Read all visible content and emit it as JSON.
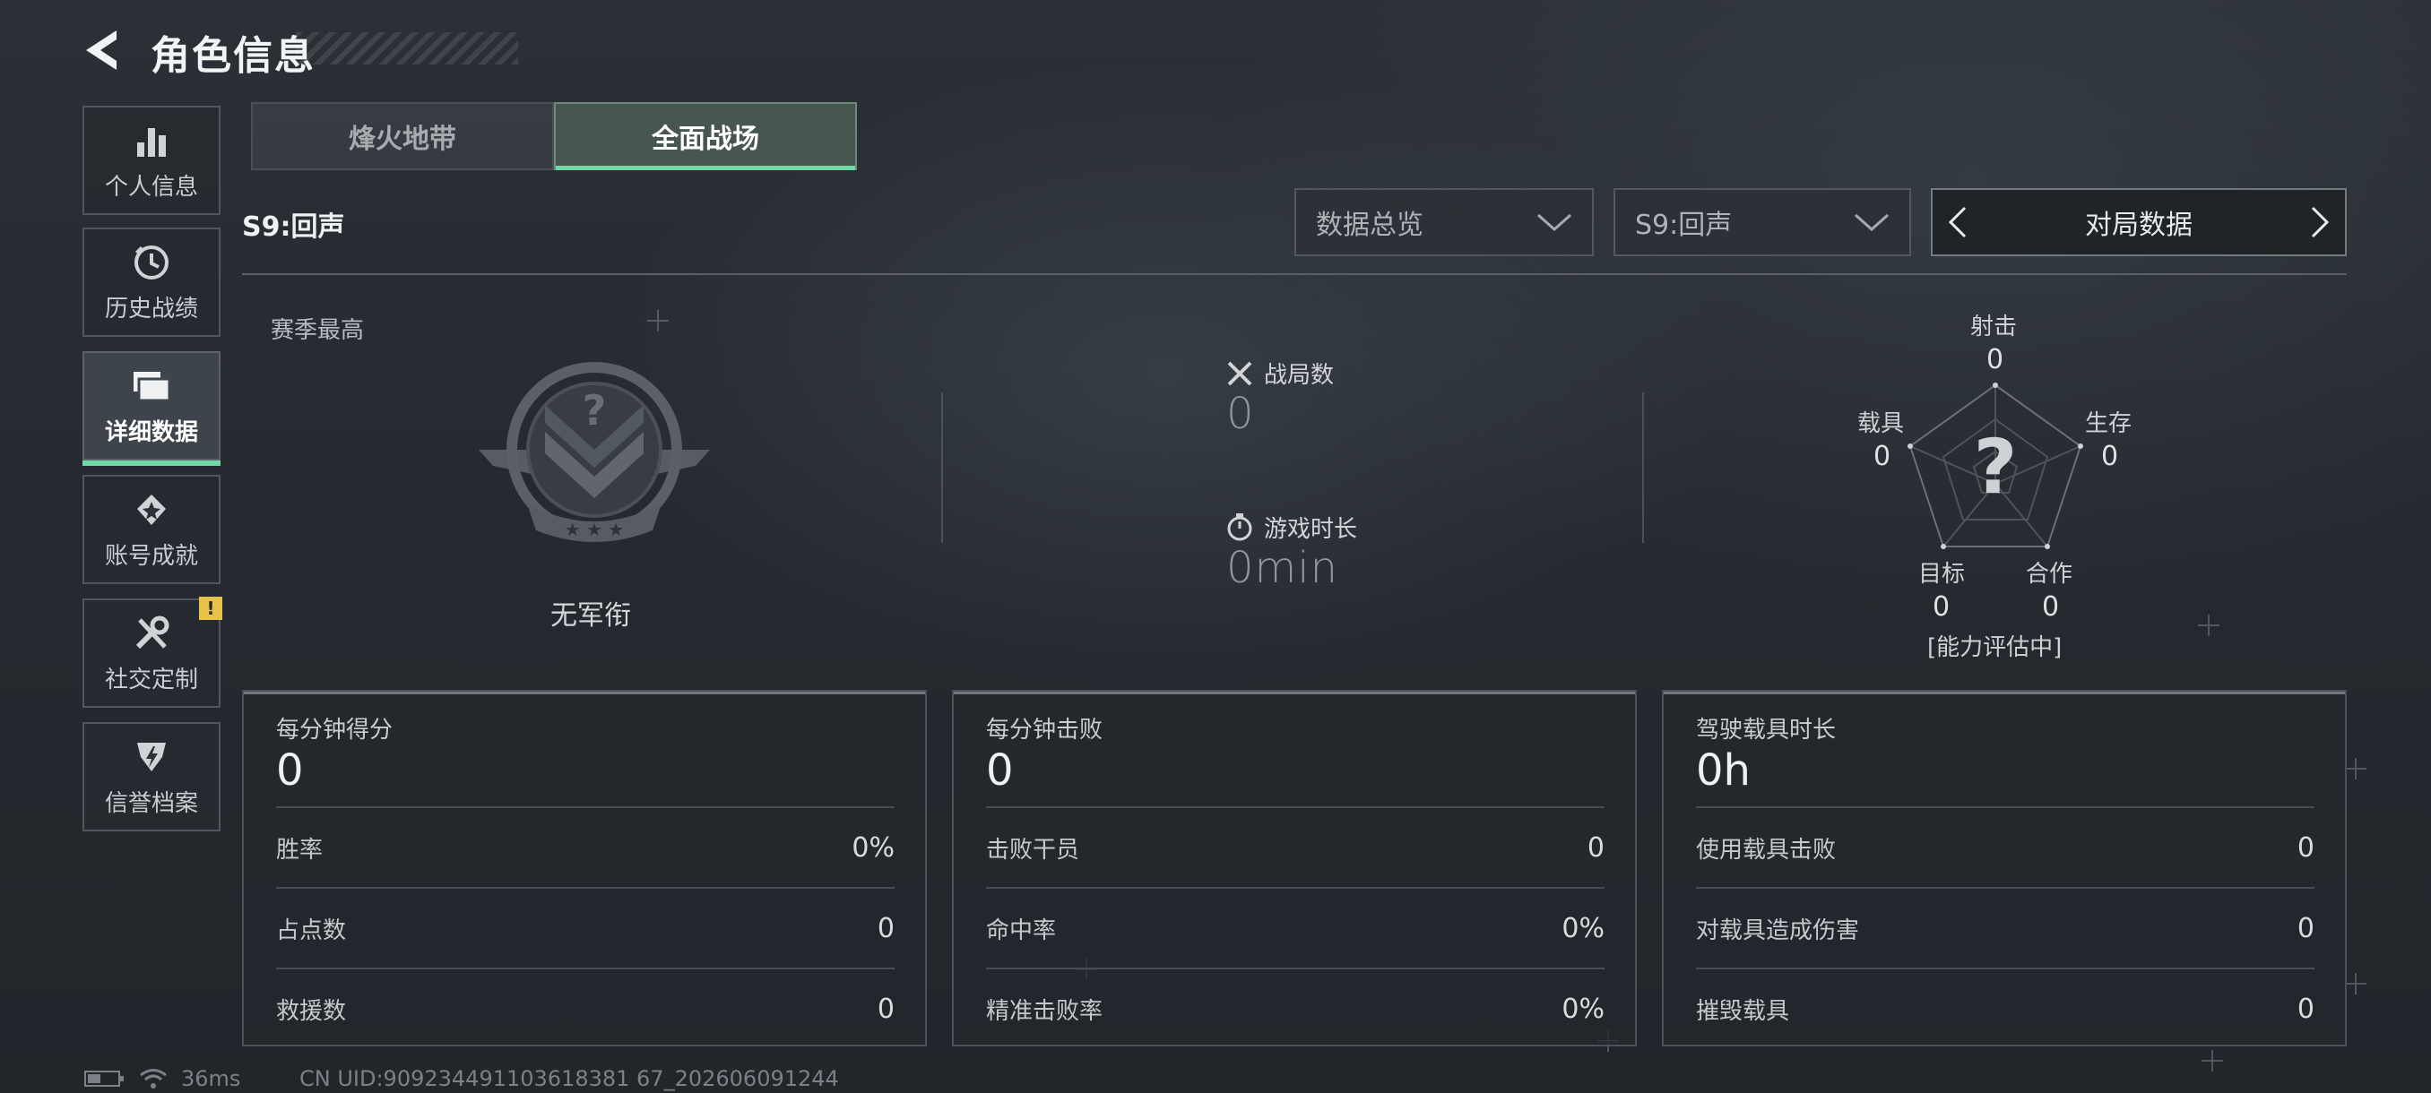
{
  "header": {
    "title": "角色信息"
  },
  "sidebar": {
    "items": [
      {
        "label": "个人信息",
        "icon": "bar-chart-icon"
      },
      {
        "label": "历史战绩",
        "icon": "history-clock-icon"
      },
      {
        "label": "详细数据",
        "icon": "folder-data-icon",
        "active": true
      },
      {
        "label": "账号成就",
        "icon": "achievement-badge-icon"
      },
      {
        "label": "社交定制",
        "icon": "wrench-tools-icon",
        "badge": "!"
      },
      {
        "label": "信誉档案",
        "icon": "credit-shield-icon"
      }
    ]
  },
  "mode_tabs": {
    "tab1": "烽火地带",
    "tab2": "全面战场",
    "active": "全面战场"
  },
  "season": {
    "label": "S9:回声"
  },
  "filters": {
    "dropdown1": "数据总览",
    "dropdown2": "S9:回声",
    "pager_label": "对局数据"
  },
  "summary": {
    "season_best_label": "赛季最高",
    "rank_name": "无军衔",
    "matches_label": "战局数",
    "matches_value": "0",
    "playtime_label": "游戏时长",
    "playtime_value": "0min"
  },
  "radar": {
    "shooting_label": "射击",
    "shooting_value": "0",
    "survival_label": "生存",
    "survival_value": "0",
    "cooperation_label": "合作",
    "cooperation_value": "0",
    "objective_label": "目标",
    "objective_value": "0",
    "vehicle_label": "载具",
    "vehicle_value": "0",
    "center_mark": "?",
    "status": "[能力评估中]"
  },
  "cards": [
    {
      "title": "每分钟得分",
      "value": "0",
      "rows": [
        {
          "k": "胜率",
          "v": "0%"
        },
        {
          "k": "占点数",
          "v": "0"
        },
        {
          "k": "救援数",
          "v": "0"
        }
      ]
    },
    {
      "title": "每分钟击败",
      "value": "0",
      "rows": [
        {
          "k": "击败干员",
          "v": "0"
        },
        {
          "k": "命中率",
          "v": "0%"
        },
        {
          "k": "精准击败率",
          "v": "0%"
        }
      ]
    },
    {
      "title": "驾驶载具时长",
      "value": "0h",
      "rows": [
        {
          "k": "使用载具击败",
          "v": "0"
        },
        {
          "k": "对载具造成伤害",
          "v": "0"
        },
        {
          "k": "摧毁载具",
          "v": "0"
        }
      ]
    }
  ],
  "status_bar": {
    "ping": "36ms",
    "uid": "CN UID:909234491103618381 67_202606091244"
  },
  "colors": {
    "accent": "#6fd9a7",
    "warning": "#e8c34a"
  }
}
